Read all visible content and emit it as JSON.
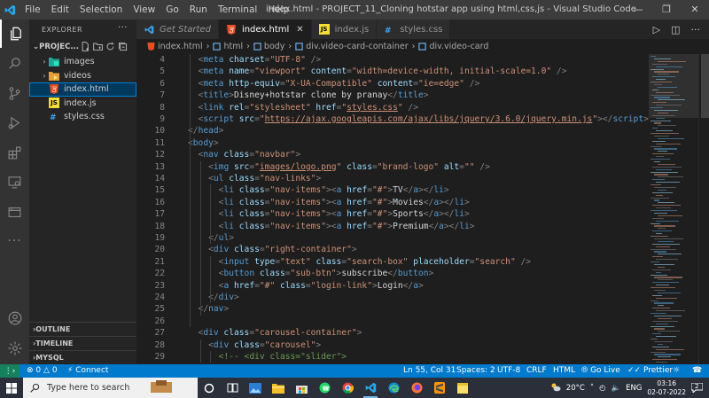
{
  "window": {
    "menu": [
      "File",
      "Edit",
      "Selection",
      "View",
      "Go",
      "Run",
      "Terminal",
      "Help"
    ],
    "title": "index.html - PROJECT_11_Cloning hotstar app using html,css,js - Visual Studio Code"
  },
  "sidebar": {
    "header": "EXPLORER",
    "project": "PROJEC...",
    "items": [
      {
        "label": "images",
        "type": "folder"
      },
      {
        "label": "videos",
        "type": "folder"
      },
      {
        "label": "index.html",
        "type": "html"
      },
      {
        "label": "index.js",
        "type": "js"
      },
      {
        "label": "styles.css",
        "type": "css"
      }
    ],
    "sections": [
      "OUTLINE",
      "TIMELINE",
      "MYSQL"
    ]
  },
  "tabs": [
    {
      "label": "Get Started",
      "icon": "vscode-icon"
    },
    {
      "label": "index.html",
      "icon": "html5-icon"
    },
    {
      "label": "index.js",
      "icon": "js-icon"
    },
    {
      "label": "styles.css",
      "icon": "css-icon"
    }
  ],
  "breadcrumb": [
    "index.html",
    "html",
    "body",
    "div.video-card-container",
    "div.video-card"
  ],
  "code_lines": [
    {
      "n": "4",
      "indent": 1,
      "parts": [
        [
          "b",
          "<"
        ],
        [
          "t",
          "meta"
        ],
        [
          "a",
          " charset"
        ],
        [
          "b",
          "="
        ],
        [
          "s",
          "\"UTF-8\""
        ],
        [
          "b",
          " />"
        ]
      ]
    },
    {
      "n": "5",
      "indent": 1,
      "parts": [
        [
          "b",
          "<"
        ],
        [
          "t",
          "meta"
        ],
        [
          "a",
          " name"
        ],
        [
          "b",
          "="
        ],
        [
          "s",
          "\"viewport\""
        ],
        [
          "a",
          " content"
        ],
        [
          "b",
          "="
        ],
        [
          "s",
          "\"width=device-width, initial-scale=1.0\""
        ],
        [
          "b",
          " />"
        ]
      ]
    },
    {
      "n": "6",
      "indent": 1,
      "parts": [
        [
          "b",
          "<"
        ],
        [
          "t",
          "meta"
        ],
        [
          "a",
          " http-equiv"
        ],
        [
          "b",
          "="
        ],
        [
          "s",
          "\"X-UA-Compatible\""
        ],
        [
          "a",
          " content"
        ],
        [
          "b",
          "="
        ],
        [
          "s",
          "\"ie=edge\""
        ],
        [
          "b",
          " />"
        ]
      ]
    },
    {
      "n": "7",
      "indent": 1,
      "parts": [
        [
          "b",
          "<"
        ],
        [
          "t",
          "title"
        ],
        [
          "b",
          ">"
        ],
        [
          "x",
          "Disney+hotstar clone by pranay"
        ],
        [
          "b",
          "</"
        ],
        [
          "t",
          "title"
        ],
        [
          "b",
          ">"
        ]
      ]
    },
    {
      "n": "8",
      "indent": 1,
      "parts": [
        [
          "b",
          "<"
        ],
        [
          "t",
          "link"
        ],
        [
          "a",
          " rel"
        ],
        [
          "b",
          "="
        ],
        [
          "s",
          "\"stylesheet\""
        ],
        [
          "a",
          " href"
        ],
        [
          "b",
          "="
        ],
        [
          "s",
          "\""
        ],
        [
          "l",
          "styles.css"
        ],
        [
          "s",
          "\""
        ],
        [
          "b",
          " />"
        ]
      ]
    },
    {
      "n": "9",
      "indent": 1,
      "parts": [
        [
          "b",
          "<"
        ],
        [
          "t",
          "script"
        ],
        [
          "a",
          " src"
        ],
        [
          "b",
          "="
        ],
        [
          "s",
          "\""
        ],
        [
          "l",
          "https://ajax.googleapis.com/ajax/libs/jquery/3.6.0/jquery.min.js"
        ],
        [
          "s",
          "\""
        ],
        [
          "b",
          "></"
        ],
        [
          "t",
          "script"
        ],
        [
          "b",
          ">"
        ]
      ]
    },
    {
      "n": "10",
      "indent": 0,
      "parts": [
        [
          "b",
          "</"
        ],
        [
          "t",
          "head"
        ],
        [
          "b",
          ">"
        ]
      ]
    },
    {
      "n": "11",
      "indent": 0,
      "parts": [
        [
          "b",
          "<"
        ],
        [
          "t",
          "body"
        ],
        [
          "b",
          ">"
        ]
      ]
    },
    {
      "n": "12",
      "indent": 1,
      "parts": [
        [
          "b",
          "<"
        ],
        [
          "t",
          "nav"
        ],
        [
          "a",
          " class"
        ],
        [
          "b",
          "="
        ],
        [
          "s",
          "\"navbar\""
        ],
        [
          "b",
          ">"
        ]
      ]
    },
    {
      "n": "13",
      "indent": 2,
      "parts": [
        [
          "b",
          "<"
        ],
        [
          "t",
          "img"
        ],
        [
          "a",
          " src"
        ],
        [
          "b",
          "="
        ],
        [
          "s",
          "\""
        ],
        [
          "l",
          "images/logo.png"
        ],
        [
          "s",
          "\""
        ],
        [
          "a",
          " class"
        ],
        [
          "b",
          "="
        ],
        [
          "s",
          "\"brand-logo\""
        ],
        [
          "a",
          " alt"
        ],
        [
          "b",
          "="
        ],
        [
          "s",
          "\"\""
        ],
        [
          "b",
          " />"
        ]
      ]
    },
    {
      "n": "14",
      "indent": 2,
      "parts": [
        [
          "b",
          "<"
        ],
        [
          "t",
          "ul"
        ],
        [
          "a",
          " class"
        ],
        [
          "b",
          "="
        ],
        [
          "s",
          "\"nav-links\""
        ],
        [
          "b",
          ">"
        ]
      ]
    },
    {
      "n": "15",
      "indent": 3,
      "parts": [
        [
          "b",
          "<"
        ],
        [
          "t",
          "li"
        ],
        [
          "a",
          " class"
        ],
        [
          "b",
          "="
        ],
        [
          "s",
          "\"nav-items\""
        ],
        [
          "b",
          "><"
        ],
        [
          "t",
          "a"
        ],
        [
          "a",
          " href"
        ],
        [
          "b",
          "="
        ],
        [
          "s",
          "\"#\""
        ],
        [
          "b",
          ">"
        ],
        [
          "x",
          "TV"
        ],
        [
          "b",
          "</"
        ],
        [
          "t",
          "a"
        ],
        [
          "b",
          "></"
        ],
        [
          "t",
          "li"
        ],
        [
          "b",
          ">"
        ]
      ]
    },
    {
      "n": "16",
      "indent": 3,
      "parts": [
        [
          "b",
          "<"
        ],
        [
          "t",
          "li"
        ],
        [
          "a",
          " class"
        ],
        [
          "b",
          "="
        ],
        [
          "s",
          "\"nav-items\""
        ],
        [
          "b",
          "><"
        ],
        [
          "t",
          "a"
        ],
        [
          "a",
          " href"
        ],
        [
          "b",
          "="
        ],
        [
          "s",
          "\"#\""
        ],
        [
          "b",
          ">"
        ],
        [
          "x",
          "Movies"
        ],
        [
          "b",
          "</"
        ],
        [
          "t",
          "a"
        ],
        [
          "b",
          "></"
        ],
        [
          "t",
          "li"
        ],
        [
          "b",
          ">"
        ]
      ]
    },
    {
      "n": "17",
      "indent": 3,
      "parts": [
        [
          "b",
          "<"
        ],
        [
          "t",
          "li"
        ],
        [
          "a",
          " class"
        ],
        [
          "b",
          "="
        ],
        [
          "s",
          "\"nav-items\""
        ],
        [
          "b",
          "><"
        ],
        [
          "t",
          "a"
        ],
        [
          "a",
          " href"
        ],
        [
          "b",
          "="
        ],
        [
          "s",
          "\"#\""
        ],
        [
          "b",
          ">"
        ],
        [
          "x",
          "Sports"
        ],
        [
          "b",
          "</"
        ],
        [
          "t",
          "a"
        ],
        [
          "b",
          "></"
        ],
        [
          "t",
          "li"
        ],
        [
          "b",
          ">"
        ]
      ]
    },
    {
      "n": "18",
      "indent": 3,
      "parts": [
        [
          "b",
          "<"
        ],
        [
          "t",
          "li"
        ],
        [
          "a",
          " class"
        ],
        [
          "b",
          "="
        ],
        [
          "s",
          "\"nav-items\""
        ],
        [
          "b",
          "><"
        ],
        [
          "t",
          "a"
        ],
        [
          "a",
          " href"
        ],
        [
          "b",
          "="
        ],
        [
          "s",
          "\"#\""
        ],
        [
          "b",
          ">"
        ],
        [
          "x",
          "Premium"
        ],
        [
          "b",
          "</"
        ],
        [
          "t",
          "a"
        ],
        [
          "b",
          "></"
        ],
        [
          "t",
          "li"
        ],
        [
          "b",
          ">"
        ]
      ]
    },
    {
      "n": "19",
      "indent": 2,
      "parts": [
        [
          "b",
          "</"
        ],
        [
          "t",
          "ul"
        ],
        [
          "b",
          ">"
        ]
      ]
    },
    {
      "n": "20",
      "indent": 2,
      "parts": [
        [
          "b",
          "<"
        ],
        [
          "t",
          "div"
        ],
        [
          "a",
          " class"
        ],
        [
          "b",
          "="
        ],
        [
          "s",
          "\"right-container\""
        ],
        [
          "b",
          ">"
        ]
      ]
    },
    {
      "n": "21",
      "indent": 3,
      "parts": [
        [
          "b",
          "<"
        ],
        [
          "t",
          "input"
        ],
        [
          "a",
          " type"
        ],
        [
          "b",
          "="
        ],
        [
          "s",
          "\"text\""
        ],
        [
          "a",
          " class"
        ],
        [
          "b",
          "="
        ],
        [
          "s",
          "\"search-box\""
        ],
        [
          "a",
          " placeholder"
        ],
        [
          "b",
          "="
        ],
        [
          "s",
          "\"search\""
        ],
        [
          "b",
          " />"
        ]
      ]
    },
    {
      "n": "22",
      "indent": 3,
      "parts": [
        [
          "b",
          "<"
        ],
        [
          "t",
          "button"
        ],
        [
          "a",
          " class"
        ],
        [
          "b",
          "="
        ],
        [
          "s",
          "\"sub-btn\""
        ],
        [
          "b",
          ">"
        ],
        [
          "x",
          "subscribe"
        ],
        [
          "b",
          "</"
        ],
        [
          "t",
          "button"
        ],
        [
          "b",
          ">"
        ]
      ]
    },
    {
      "n": "23",
      "indent": 3,
      "parts": [
        [
          "b",
          "<"
        ],
        [
          "t",
          "a"
        ],
        [
          "a",
          " href"
        ],
        [
          "b",
          "="
        ],
        [
          "s",
          "\"#\""
        ],
        [
          "a",
          " class"
        ],
        [
          "b",
          "="
        ],
        [
          "s",
          "\"login-link\""
        ],
        [
          "b",
          ">"
        ],
        [
          "x",
          "Login"
        ],
        [
          "b",
          "</"
        ],
        [
          "t",
          "a"
        ],
        [
          "b",
          ">"
        ]
      ]
    },
    {
      "n": "24",
      "indent": 2,
      "parts": [
        [
          "b",
          "</"
        ],
        [
          "t",
          "div"
        ],
        [
          "b",
          ">"
        ]
      ]
    },
    {
      "n": "25",
      "indent": 1,
      "parts": [
        [
          "b",
          "</"
        ],
        [
          "t",
          "nav"
        ],
        [
          "b",
          ">"
        ]
      ]
    },
    {
      "n": "26",
      "indent": 0,
      "parts": []
    },
    {
      "n": "27",
      "indent": 1,
      "parts": [
        [
          "b",
          "<"
        ],
        [
          "t",
          "div"
        ],
        [
          "a",
          " class"
        ],
        [
          "b",
          "="
        ],
        [
          "s",
          "\"carousel-container\""
        ],
        [
          "b",
          ">"
        ]
      ]
    },
    {
      "n": "28",
      "indent": 2,
      "parts": [
        [
          "b",
          "<"
        ],
        [
          "t",
          "div"
        ],
        [
          "a",
          " class"
        ],
        [
          "b",
          "="
        ],
        [
          "s",
          "\"carousel\""
        ],
        [
          "b",
          ">"
        ]
      ]
    },
    {
      "n": "29",
      "indent": 3,
      "parts": [
        [
          "c",
          "<!-- <div class=\"slider\">"
        ]
      ]
    }
  ],
  "statusbar": {
    "errors": "0",
    "warnings": "0",
    "connect": "Connect",
    "position": "Ln 55, Col 31",
    "spaces": "Spaces: 2",
    "encoding": "UTF-8",
    "eol": "CRLF",
    "language": "HTML",
    "golive": "Go Live",
    "prettier": "Prettier"
  },
  "taskbar": {
    "search_placeholder": "Type here to search",
    "weather": "20°C",
    "lang": "ENG",
    "time": "03:16",
    "date": "02-07-2022",
    "notifications": "2"
  },
  "colors": {
    "accent": "#007acc",
    "tag": "#569cd6",
    "attr": "#9cdcfe",
    "string": "#ce9178",
    "comment": "#6a9955"
  }
}
